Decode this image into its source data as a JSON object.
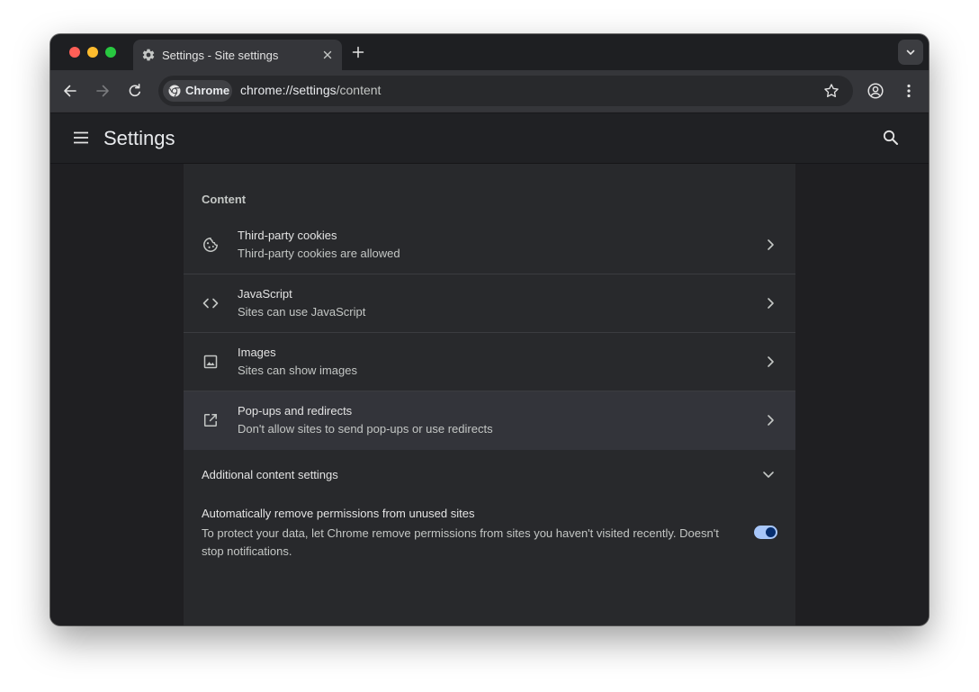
{
  "tab": {
    "title": "Settings - Site settings",
    "icon": "gear-icon"
  },
  "toolbar": {
    "chip_label": "Chrome",
    "url_host": "chrome://settings",
    "url_path": "/content"
  },
  "header": {
    "title": "Settings"
  },
  "content": {
    "section_title": "Content",
    "rows": [
      {
        "title": "Third-party cookies",
        "subtitle": "Third-party cookies are allowed",
        "icon": "cookie-icon"
      },
      {
        "title": "JavaScript",
        "subtitle": "Sites can use JavaScript",
        "icon": "code-icon"
      },
      {
        "title": "Images",
        "subtitle": "Sites can show images",
        "icon": "image-icon"
      },
      {
        "title": "Pop-ups and redirects",
        "subtitle": "Don't allow sites to send pop-ups or use redirects",
        "icon": "open-in-new-icon",
        "highlighted": true
      }
    ],
    "additional_label": "Additional content settings",
    "permissions": {
      "title": "Automatically remove permissions from unused sites",
      "description": "To protect your data, let Chrome remove permissions from sites you haven't visited recently. Doesn't stop notifications.",
      "enabled": true
    }
  },
  "colors": {
    "accent": "#a8c7fa",
    "toggle_knob": "#062e6f",
    "background": "#1f1f22",
    "card": "#28292c"
  }
}
